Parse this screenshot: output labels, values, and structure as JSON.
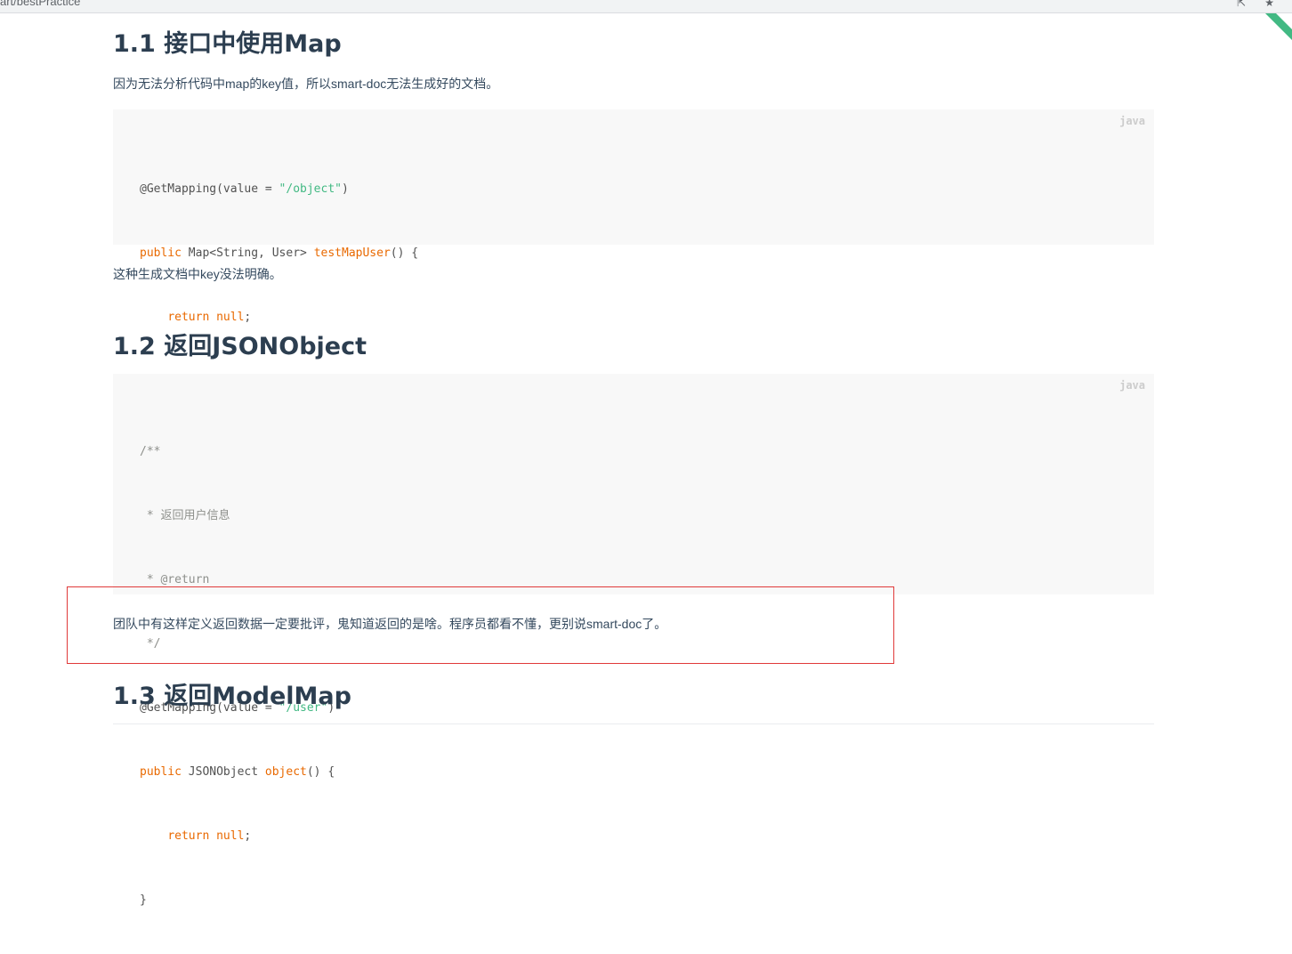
{
  "browser": {
    "url_fragment": "art/bestPractice"
  },
  "sections": {
    "s1": {
      "heading": "1.1 接口中使用Map",
      "intro": "因为无法分析代码中map的key值，所以smart-doc无法生成好的文档。",
      "code_lang": "java",
      "code": [
        [
          "@GetMapping(value = ",
          "\"/object\"",
          ")"
        ],
        [
          "public",
          " Map<String, User> ",
          "testMapUser",
          "() {"
        ],
        [
          "    ",
          "return",
          " ",
          "null",
          ";"
        ],
        [
          "}"
        ]
      ],
      "after": "这种生成文档中key没法明确。"
    },
    "s2": {
      "heading": "1.2 返回JSONObject",
      "code_lang": "java",
      "comment": [
        "/**",
        " * 返回用户信息",
        " * @return",
        " */"
      ],
      "annotation": [
        "@GetMapping(value = ",
        "\"/user\"",
        ")"
      ],
      "sig": [
        "public",
        " JSONObject ",
        "object",
        "() {"
      ],
      "body": [
        "    ",
        "return",
        " ",
        "null",
        ";"
      ],
      "close": "}",
      "after": "团队中有这样定义返回数据一定要批评，鬼知道返回的是啥。程序员都看不懂，更别说smart-doc了。"
    },
    "s3": {
      "heading": "1.3 返回ModelMap"
    }
  },
  "colors": {
    "keyword": "#e96900",
    "string": "#42b983",
    "accent": "#42b983",
    "highlight_border": "#e03a3a"
  }
}
